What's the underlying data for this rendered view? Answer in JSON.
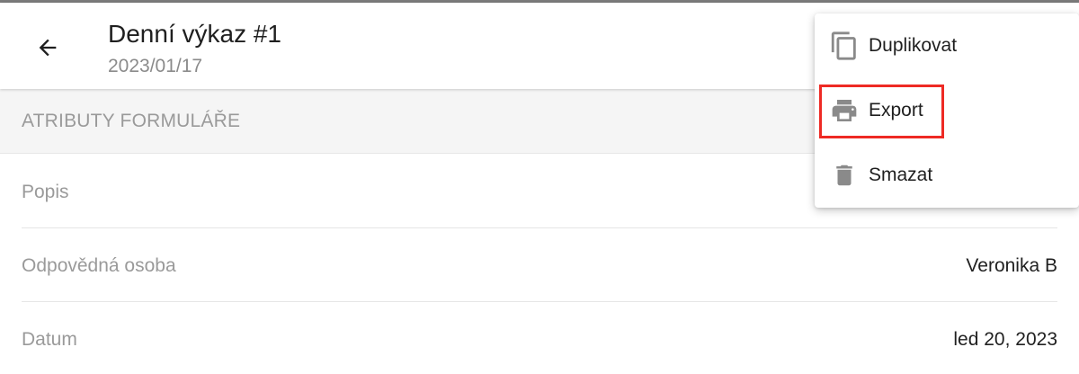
{
  "header": {
    "title": "Denní výkaz #1",
    "subtitle": "2023/01/17",
    "back_icon": "arrow-left-icon"
  },
  "section": {
    "title": "ATRIBUTY FORMULÁŘE"
  },
  "fields": [
    {
      "label": "Popis",
      "value": ""
    },
    {
      "label": "Odpovědná osoba",
      "value": "Veronika B"
    },
    {
      "label": "Datum",
      "value": "led 20, 2023"
    }
  ],
  "menu": {
    "items": [
      {
        "label": "Duplikovat",
        "icon": "copy-icon"
      },
      {
        "label": "Export",
        "icon": "print-icon",
        "highlighted": true
      },
      {
        "label": "Smazat",
        "icon": "trash-icon"
      }
    ]
  },
  "colors": {
    "highlight": "#ee2a24",
    "icon_gray": "#8a8a8a",
    "muted_text": "#9a9a9a"
  }
}
